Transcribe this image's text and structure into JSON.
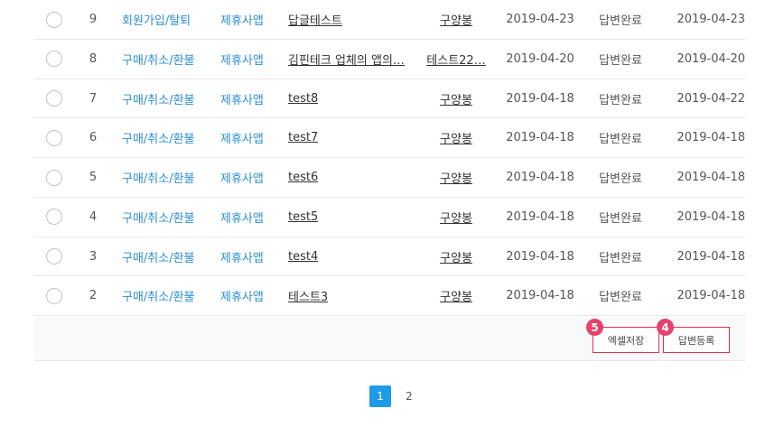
{
  "rows": [
    {
      "num": "9",
      "category": "회원가입/탈퇴",
      "channel": "제휴사앱",
      "title": "답글테스트",
      "author": "구양봉",
      "created": "2019-04-23",
      "status": "답변완료",
      "answered": "2019-04-23"
    },
    {
      "num": "8",
      "category": "구매/취소/환불",
      "channel": "제휴사앱",
      "title": "김핀테크 업체의 앱의…",
      "author": "테스트22…",
      "created": "2019-04-20",
      "status": "답변완료",
      "answered": "2019-04-20"
    },
    {
      "num": "7",
      "category": "구매/취소/환불",
      "channel": "제휴사앱",
      "title": "test8",
      "author": "구양봉",
      "created": "2019-04-18",
      "status": "답변완료",
      "answered": "2019-04-22"
    },
    {
      "num": "6",
      "category": "구매/취소/환불",
      "channel": "제휴사앱",
      "title": "test7",
      "author": "구양봉",
      "created": "2019-04-18",
      "status": "답변완료",
      "answered": "2019-04-18"
    },
    {
      "num": "5",
      "category": "구매/취소/환불",
      "channel": "제휴사앱",
      "title": "test6",
      "author": "구양봉",
      "created": "2019-04-18",
      "status": "답변완료",
      "answered": "2019-04-18"
    },
    {
      "num": "4",
      "category": "구매/취소/환불",
      "channel": "제휴사앱",
      "title": "test5",
      "author": "구양봉",
      "created": "2019-04-18",
      "status": "답변완료",
      "answered": "2019-04-18"
    },
    {
      "num": "3",
      "category": "구매/취소/환불",
      "channel": "제휴사앱",
      "title": "test4",
      "author": "구양봉",
      "created": "2019-04-18",
      "status": "답변완료",
      "answered": "2019-04-18"
    },
    {
      "num": "2",
      "category": "구매/취소/환불",
      "channel": "제휴사앱",
      "title": "테스트3",
      "author": "구양봉",
      "created": "2019-04-18",
      "status": "답변완료",
      "answered": "2019-04-18"
    }
  ],
  "actions": {
    "excel_label": "엑셀저장",
    "excel_badge": "5",
    "answer_label": "답변등록",
    "answer_badge": "4"
  },
  "pagination": {
    "pages": [
      "1",
      "2"
    ],
    "current": "1"
  },
  "colors": {
    "link_blue": "#2b8fd6",
    "button_border": "#e0334f",
    "badge": "#e8416b",
    "page_active": "#1e9be8"
  }
}
